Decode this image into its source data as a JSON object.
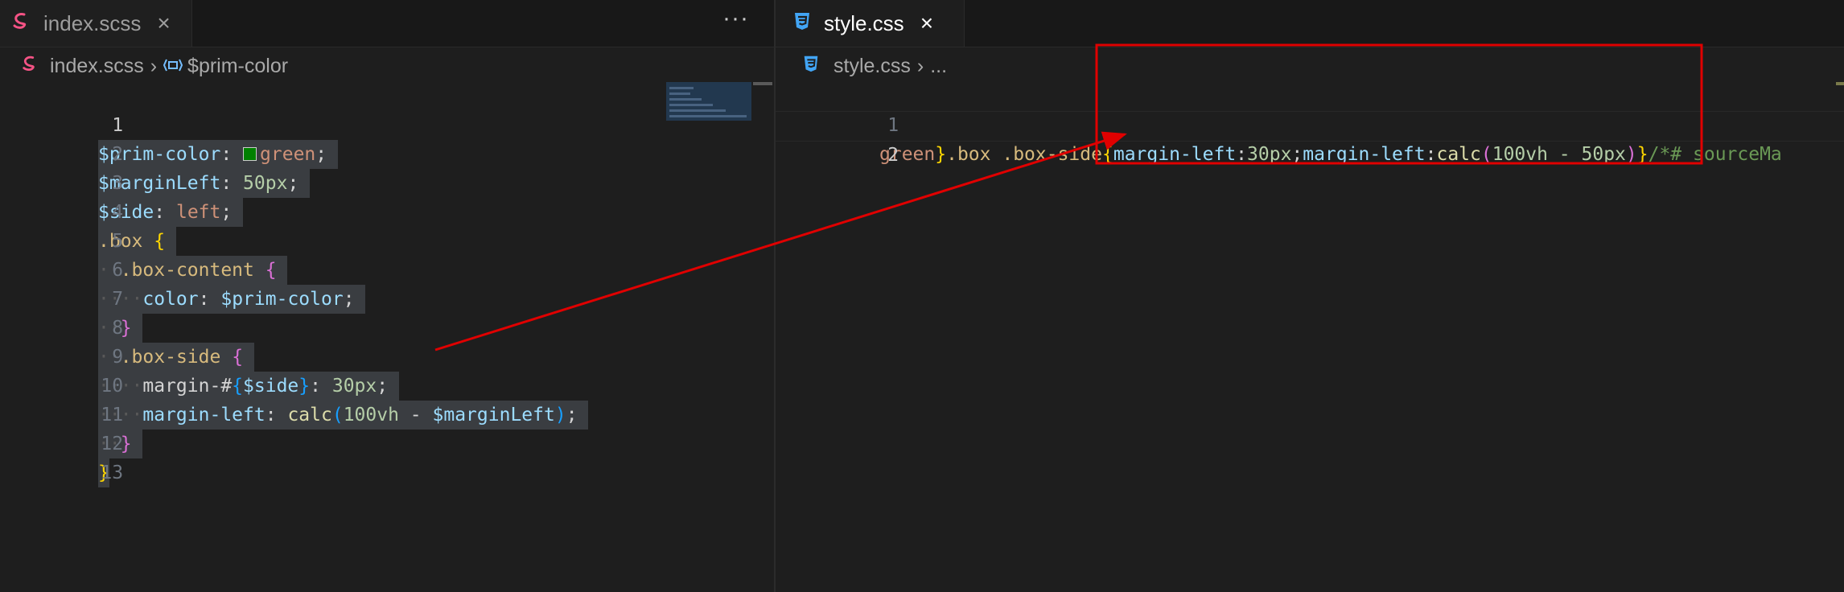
{
  "left_editor": {
    "tab": {
      "label": "index.scss",
      "icon": "sass-icon",
      "close": "×"
    },
    "more_actions": "···",
    "breadcrumb": {
      "file": "index.scss",
      "symbol": "$prim-color"
    },
    "line_numbers": [
      "1",
      "2",
      "3",
      "4",
      "5",
      "6",
      "7",
      "8",
      "9",
      "10",
      "11",
      "12",
      "13"
    ],
    "code": {
      "l1": {
        "var": "$prim-color",
        "colon": ":",
        "value": "green",
        "semi": ";"
      },
      "l2": {
        "var": "$marginLeft",
        "colon": ":",
        "value": "50px",
        "semi": ";"
      },
      "l3": {
        "var": "$side",
        "colon": ":",
        "value": "left",
        "semi": ";"
      },
      "l4": {
        "selector": ".box",
        "brace": "{"
      },
      "l5": {
        "selector": ".box-content",
        "brace": "{"
      },
      "l6": {
        "prop": "color",
        "colon": ":",
        "value": "$prim-color",
        "semi": ";"
      },
      "l7": {
        "brace": "}"
      },
      "l8": {
        "selector": ".box-side",
        "brace": "{"
      },
      "l9": {
        "prop": "margin-#",
        "interp_open": "{",
        "interp_var": "$side",
        "interp_close": "}",
        "colon": ":",
        "value": "30px",
        "semi": ";"
      },
      "l10": {
        "prop": "margin-left",
        "colon": ":",
        "func": "calc",
        "paren_open": "(",
        "arg1": "100vh",
        "op": "-",
        "arg2": "$marginLeft",
        "paren_close": ")",
        "semi": ";"
      },
      "l11": {
        "brace": "}"
      },
      "l12": {
        "brace": "}"
      }
    }
  },
  "right_editor": {
    "tab": {
      "label": "style.css",
      "icon": "css3-icon",
      "close": "×"
    },
    "breadcrumb": {
      "file": "style.css",
      "rest": "..."
    },
    "line_numbers": [
      "1",
      "2"
    ],
    "code": {
      "l1": {
        "t1": "green",
        "t2": "}",
        "t3": ".box .box-side",
        "t4": "{",
        "t5": "margin-left",
        "t6": ":",
        "t7": "30px",
        "t8": ";",
        "t9": "margin-left",
        "t10": ":",
        "t11": "calc",
        "t12": "(",
        "t13": "100vh - 50px",
        "t14": ")",
        "t15": "}",
        "t16": "/*# sourceMa"
      }
    }
  },
  "annotation": {
    "color": "#e00000"
  },
  "colors": {
    "background": "#1e1e1e",
    "selection": "#3a3d41",
    "variable": "#9cdcfe",
    "string": "#ce9178",
    "number": "#b5cea8",
    "selector": "#d7ba7d",
    "function": "#dcdcaa",
    "bracket_yellow": "#ffd700",
    "bracket_magenta": "#da70d6",
    "bracket_blue": "#179fff",
    "sass_pink": "#f55385",
    "css_blue": "#42a5f5"
  }
}
